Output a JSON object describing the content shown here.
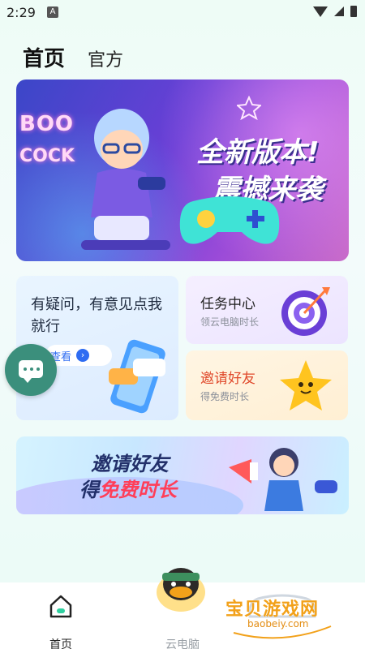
{
  "status_bar": {
    "time": "2:29",
    "notification_letter": "A"
  },
  "header": {
    "tab_home": "首页",
    "tab_official": "官方"
  },
  "hero": {
    "sign_line1": "BOO",
    "sign_line2": "COCK",
    "title_line1": "全新版本!",
    "title_line2": "震撼来袭"
  },
  "feedback_card": {
    "text": "有疑问，有意见点我就行",
    "view_label": "查看"
  },
  "task_card": {
    "title": "任务中心",
    "subtitle": "领云电脑时长"
  },
  "invite_card": {
    "title": "邀请好友",
    "subtitle": "得免费时长"
  },
  "invite_banner": {
    "line1": "邀请好友",
    "line2_prefix": "得",
    "line2_highlight": "免费时长"
  },
  "bottom_nav": {
    "home_label": "首页",
    "cloud_label": "云电脑"
  },
  "watermark": {
    "text": "宝贝游戏网",
    "url": "baobeiy.com"
  },
  "colors": {
    "accent_blue": "#2e6cf2",
    "chat_green": "#3b8f7c",
    "invite_red": "#e0492b",
    "highlight_red": "#ff3e59"
  },
  "icons": {
    "home": "home-icon",
    "chat": "chat-icon",
    "target": "target-icon",
    "star": "star-icon",
    "arrow": "arrow-right-icon"
  }
}
